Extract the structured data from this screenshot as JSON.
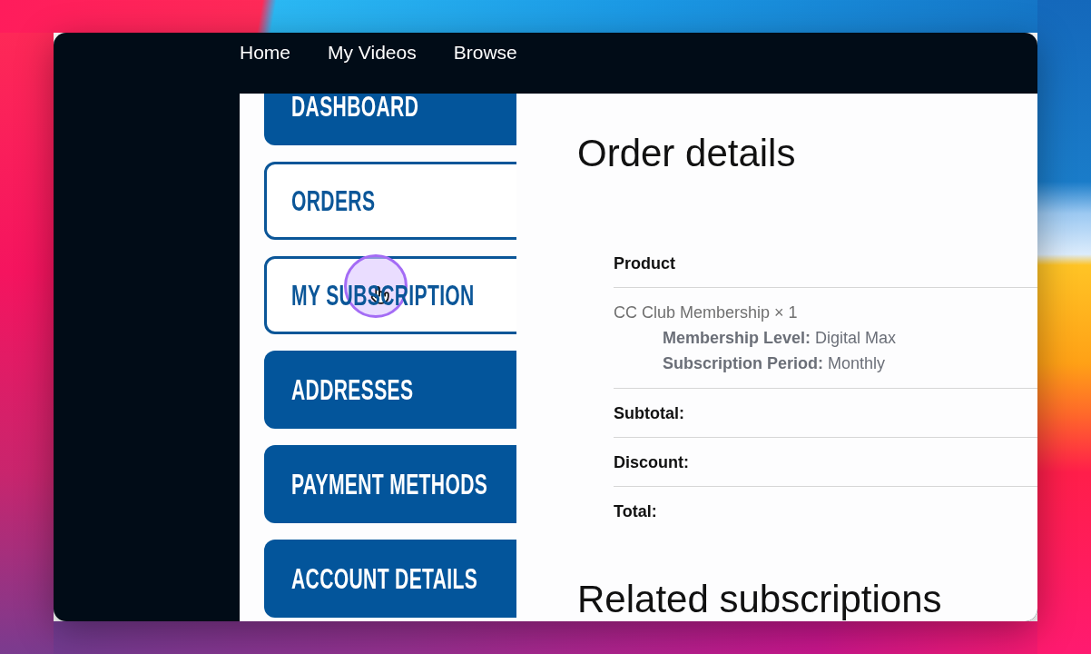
{
  "nav_links": [
    {
      "label": "Home"
    },
    {
      "label": "My Videos"
    },
    {
      "label": "Browse"
    }
  ],
  "account_menu": [
    {
      "label": "DASHBOARD",
      "highlighted": false,
      "hovered": false
    },
    {
      "label": "ORDERS",
      "highlighted": true,
      "hovered": false
    },
    {
      "label": "MY SUBSCRIPTION",
      "highlighted": true,
      "hovered": true
    },
    {
      "label": "ADDRESSES",
      "highlighted": false,
      "hovered": false
    },
    {
      "label": "PAYMENT METHODS",
      "highlighted": false,
      "hovered": false
    },
    {
      "label": "ACCOUNT DETAILS",
      "highlighted": false,
      "hovered": false
    }
  ],
  "order_details": {
    "title": "Order details",
    "table": {
      "columns": [
        "Product"
      ],
      "items": [
        {
          "name": "CC Club Membership × 1",
          "meta": [
            "**Membership Level:** Digital Max",
            "**Subscription Period:** Monthly"
          ]
        }
      ],
      "totals": [
        "Subtotal:",
        "Discount:",
        "Total:"
      ]
    }
  },
  "related_subscriptions": {
    "title": "Related subscriptions"
  }
}
